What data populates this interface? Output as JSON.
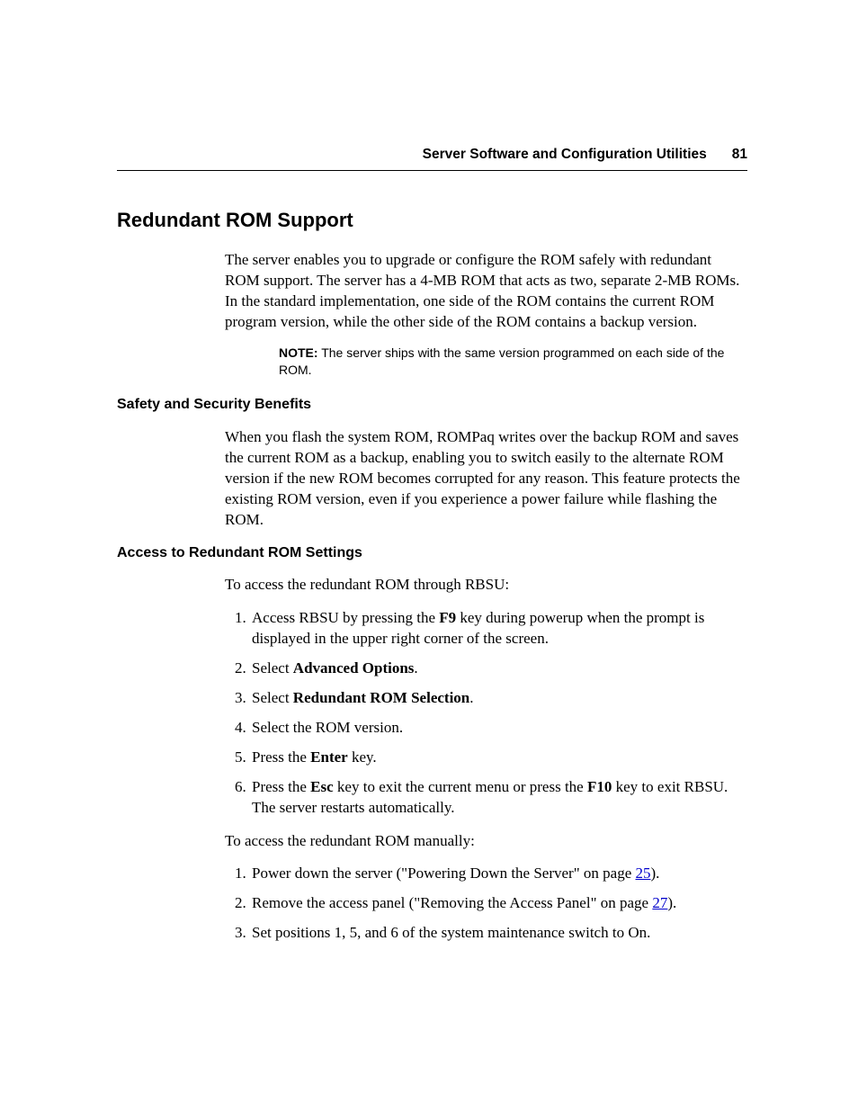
{
  "header": {
    "section": "Server Software and Configuration Utilities",
    "page_number": "81"
  },
  "title": "Redundant ROM Support",
  "intro_para": "The server enables you to upgrade or configure the ROM safely with redundant ROM support. The server has a 4-MB ROM that acts as two, separate 2-MB ROMs. In the standard implementation, one side of the ROM contains the current ROM program version, while the other side of the ROM contains a backup version.",
  "note": {
    "label": "NOTE:",
    "text": "The server ships with the same version programmed on each side of the ROM."
  },
  "safety": {
    "heading": "Safety and Security Benefits",
    "para": "When you flash the system ROM, ROMPaq writes over the backup ROM and saves the current ROM as a backup, enabling you to switch easily to the alternate ROM version if the new ROM becomes corrupted for any reason. This feature protects the existing ROM version, even if you experience a power failure while flashing the ROM."
  },
  "access": {
    "heading": "Access to Redundant ROM Settings",
    "intro": "To access the redundant ROM through RBSU:",
    "steps_rbsu": {
      "s1_a": "Access RBSU by pressing the ",
      "s1_b": "F9",
      "s1_c": " key during powerup when the prompt is displayed in the upper right corner of the screen.",
      "s2_a": "Select ",
      "s2_b": "Advanced Options",
      "s2_c": ".",
      "s3_a": "Select ",
      "s3_b": "Redundant ROM Selection",
      "s3_c": ".",
      "s4": "Select the ROM version.",
      "s5_a": "Press the ",
      "s5_b": "Enter",
      "s5_c": " key.",
      "s6_a": "Press the ",
      "s6_b": "Esc",
      "s6_c": " key to exit the current menu or press the ",
      "s6_d": "F10",
      "s6_e": " key to exit RBSU. The server restarts automatically."
    },
    "manual_intro": "To access the redundant ROM manually:",
    "steps_manual": {
      "m1_a": "Power down the server (\"Powering Down the Server\" on page ",
      "m1_link": "25",
      "m1_b": ").",
      "m2_a": "Remove the access panel (\"Removing the Access Panel\" on page ",
      "m2_link": "27",
      "m2_b": ").",
      "m3": "Set positions 1, 5, and 6 of the system maintenance switch to On."
    }
  }
}
